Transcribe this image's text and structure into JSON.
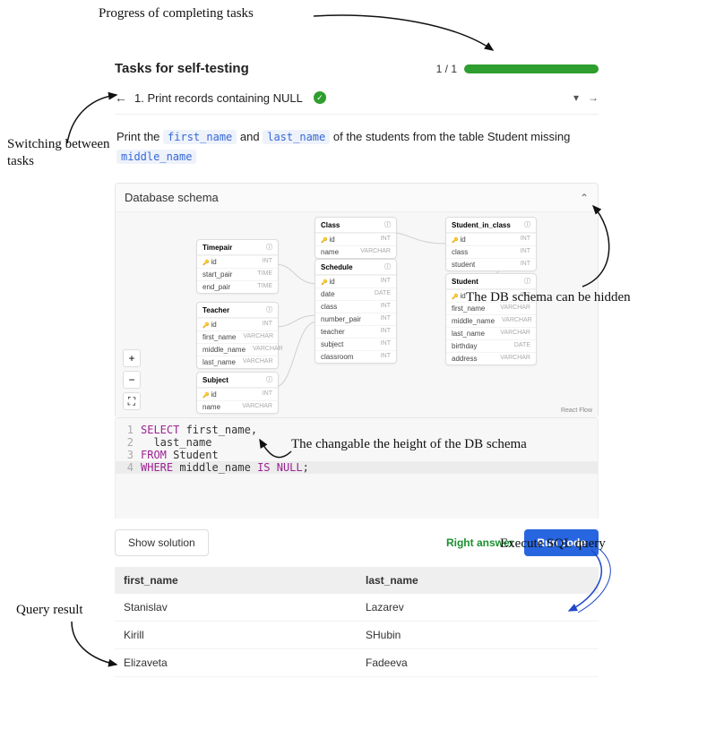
{
  "annotations": {
    "progress": "Progress of completing tasks",
    "switching": "Switching between\ntasks",
    "schema_hidden": "The DB schema can be hidden",
    "changeable_height": "The changable the height of the DB schema",
    "execute": "Execute SQL query",
    "query_result": "Query result"
  },
  "header": {
    "title": "Tasks for self-testing",
    "progress_text": "1 / 1"
  },
  "task_nav": {
    "task_label": "1. Print records containing NULL",
    "check": "✓"
  },
  "prompt": {
    "pre1": "Print the ",
    "chip1": "first_name",
    "mid1": " and ",
    "chip2": "last_name",
    "mid2": " of the students from the table Student missing ",
    "chip3": "middle_name"
  },
  "schema": {
    "label": "Database schema",
    "react_flow": "React Flow",
    "tables": {
      "timepair": {
        "name": "Timepair",
        "cols": [
          [
            "id",
            "INT",
            true
          ],
          [
            "start_pair",
            "TIME",
            false
          ],
          [
            "end_pair",
            "TIME",
            false
          ]
        ]
      },
      "teacher": {
        "name": "Teacher",
        "cols": [
          [
            "id",
            "INT",
            true
          ],
          [
            "first_name",
            "VARCHAR",
            false
          ],
          [
            "middle_name",
            "VARCHAR",
            false
          ],
          [
            "last_name",
            "VARCHAR",
            false
          ]
        ]
      },
      "subject": {
        "name": "Subject",
        "cols": [
          [
            "id",
            "INT",
            true
          ],
          [
            "name",
            "VARCHAR",
            false
          ]
        ]
      },
      "class": {
        "name": "Class",
        "cols": [
          [
            "id",
            "INT",
            true
          ],
          [
            "name",
            "VARCHAR",
            false
          ]
        ]
      },
      "schedule": {
        "name": "Schedule",
        "cols": [
          [
            "id",
            "INT",
            true
          ],
          [
            "date",
            "DATE",
            false
          ],
          [
            "class",
            "INT",
            false
          ],
          [
            "number_pair",
            "INT",
            false
          ],
          [
            "teacher",
            "INT",
            false
          ],
          [
            "subject",
            "INT",
            false
          ],
          [
            "classroom",
            "INT",
            false
          ]
        ]
      },
      "sic": {
        "name": "Student_in_class",
        "cols": [
          [
            "id",
            "INT",
            true
          ],
          [
            "class",
            "INT",
            false
          ],
          [
            "student",
            "INT",
            false
          ]
        ]
      },
      "student": {
        "name": "Student",
        "cols": [
          [
            "id",
            "INT",
            true
          ],
          [
            "first_name",
            "VARCHAR",
            false
          ],
          [
            "middle_name",
            "VARCHAR",
            false
          ],
          [
            "last_name",
            "VARCHAR",
            false
          ],
          [
            "birthday",
            "DATE",
            false
          ],
          [
            "address",
            "VARCHAR",
            false
          ]
        ]
      }
    }
  },
  "editor": {
    "lines": [
      {
        "n": "1",
        "segs": [
          [
            "SELECT ",
            "kw"
          ],
          [
            "first_name,",
            ""
          ]
        ]
      },
      {
        "n": "2",
        "segs": [
          [
            "  last_name",
            ""
          ]
        ]
      },
      {
        "n": "3",
        "segs": [
          [
            "FROM ",
            "kw"
          ],
          [
            "Student",
            ""
          ]
        ]
      },
      {
        "n": "4",
        "segs": [
          [
            "WHERE ",
            "kw"
          ],
          [
            "middle_name ",
            ""
          ],
          [
            "IS NULL",
            "kw"
          ],
          [
            ";",
            ""
          ]
        ]
      }
    ]
  },
  "runbar": {
    "show_solution": "Show solution",
    "right_answer": "Right answer",
    "run_code": "Run code"
  },
  "results": {
    "headers": [
      "first_name",
      "last_name"
    ],
    "rows": [
      [
        "Stanislav",
        "Lazarev"
      ],
      [
        "Kirill",
        "SHubin"
      ],
      [
        "Elizaveta",
        "Fadeeva"
      ]
    ]
  }
}
